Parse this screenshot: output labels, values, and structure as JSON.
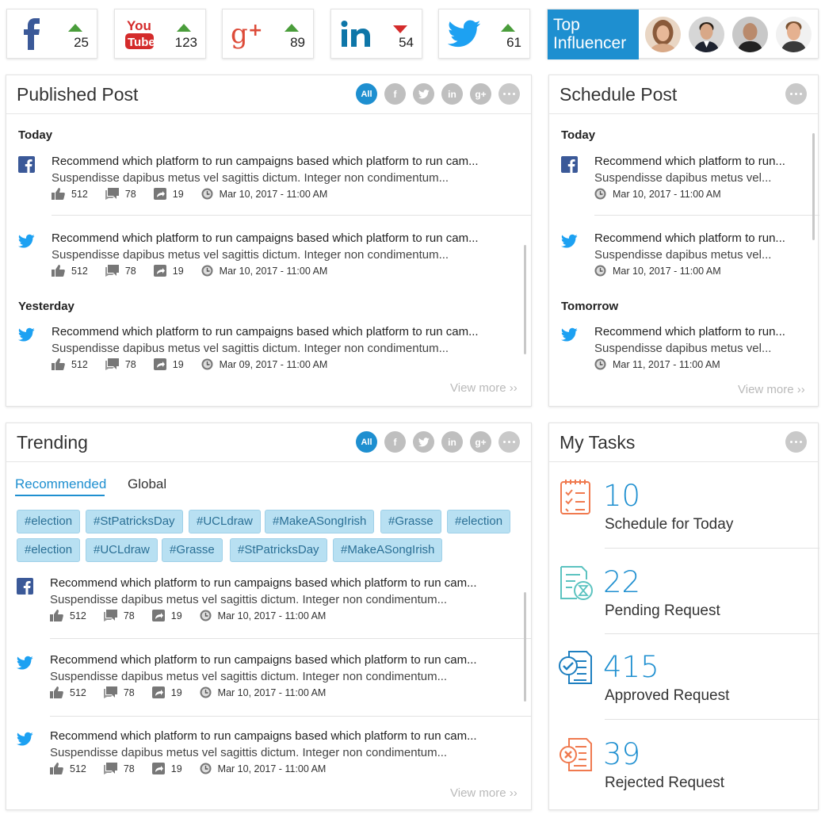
{
  "social_stats": [
    {
      "network": "facebook",
      "icon": "facebook-icon",
      "count": "25",
      "trend": "up"
    },
    {
      "network": "youtube",
      "icon": "youtube-icon",
      "count": "123",
      "trend": "up"
    },
    {
      "network": "google-plus",
      "icon": "google-plus-icon",
      "count": "89",
      "trend": "up"
    },
    {
      "network": "linkedin",
      "icon": "linkedin-icon",
      "count": "54",
      "trend": "down"
    },
    {
      "network": "twitter",
      "icon": "twitter-icon",
      "count": "61",
      "trend": "up"
    }
  ],
  "influencer": {
    "label_line1": "Top",
    "label_line2": "Influencer"
  },
  "filters": {
    "all": "All"
  },
  "published": {
    "title": "Published Post",
    "groups": [
      {
        "label": "Today"
      },
      {
        "label": "Yesterday"
      }
    ],
    "posts": [
      {
        "network": "facebook",
        "title": "Recommend which platform to run campaigns based which platform to run cam...",
        "desc": "Suspendisse dapibus metus vel sagittis dictum. Integer non condimentum...",
        "likes": "512",
        "comments": "78",
        "shares": "19",
        "date": "Mar 10, 2017 - 11:00 AM"
      },
      {
        "network": "twitter",
        "title": "Recommend which platform to run campaigns based which platform to run cam...",
        "desc": "Suspendisse dapibus metus vel sagittis dictum. Integer non condimentum...",
        "likes": "512",
        "comments": "78",
        "shares": "19",
        "date": "Mar 10, 2017 - 11:00 AM"
      },
      {
        "network": "twitter",
        "title": "Recommend which platform to run campaigns based which platform to run cam...",
        "desc": "Suspendisse dapibus metus vel sagittis dictum. Integer non condimentum...",
        "likes": "512",
        "comments": "78",
        "shares": "19",
        "date": "Mar 09, 2017 - 11:00 AM"
      }
    ],
    "view_more": "View more ››"
  },
  "schedule": {
    "title": "Schedule Post",
    "groups": [
      {
        "label": "Today"
      },
      {
        "label": "Tomorrow"
      }
    ],
    "posts": [
      {
        "network": "facebook",
        "title": "Recommend which platform to run...",
        "desc": "Suspendisse dapibus metus vel...",
        "date": "Mar 10, 2017 - 11:00 AM"
      },
      {
        "network": "twitter",
        "title": "Recommend which platform to run...",
        "desc": "Suspendisse dapibus metus vel...",
        "date": "Mar 10, 2017 - 11:00 AM"
      },
      {
        "network": "twitter",
        "title": "Recommend which platform to run...",
        "desc": "Suspendisse dapibus metus vel...",
        "date": "Mar 11, 2017 - 11:00 AM"
      }
    ],
    "view_more": "View more ››"
  },
  "trending": {
    "title": "Trending",
    "tabs": [
      {
        "label": "Recommended",
        "active": true
      },
      {
        "label": "Global",
        "active": false
      }
    ],
    "tags_row1": [
      "#election",
      "#StPatricksDay",
      "#UCLdraw",
      "#MakeASongIrish",
      "#Grasse",
      "#election"
    ],
    "tags_row2": [
      "#election",
      "#UCLdraw",
      "#Grasse",
      "#StPatricksDay",
      "#MakeASongIrish"
    ],
    "posts": [
      {
        "network": "facebook",
        "title": "Recommend which platform to run campaigns based which platform to run cam...",
        "desc": "Suspendisse dapibus metus vel sagittis dictum. Integer non condimentum...",
        "likes": "512",
        "comments": "78",
        "shares": "19",
        "date": "Mar 10, 2017 - 11:00 AM"
      },
      {
        "network": "twitter",
        "title": "Recommend which platform to run campaigns based which platform to run cam...",
        "desc": "Suspendisse dapibus metus vel sagittis dictum. Integer non condimentum...",
        "likes": "512",
        "comments": "78",
        "shares": "19",
        "date": "Mar 10, 2017 - 11:00 AM"
      },
      {
        "network": "twitter",
        "title": "Recommend which platform to run campaigns based which platform to run cam...",
        "desc": "Suspendisse dapibus metus vel sagittis dictum. Integer non condimentum...",
        "likes": "512",
        "comments": "78",
        "shares": "19",
        "date": "Mar 10, 2017 - 11:00 AM"
      }
    ],
    "view_more": "View more ››"
  },
  "tasks": {
    "title": "My Tasks",
    "items": [
      {
        "count": "10",
        "label": "Schedule for Today",
        "icon": "schedule-checklist-icon",
        "color": "#f07a4f"
      },
      {
        "count": "22",
        "label": "Pending Request",
        "icon": "pending-hourglass-icon",
        "color": "#5cc3c0"
      },
      {
        "count": "415",
        "label": "Approved Request",
        "icon": "approved-check-icon",
        "color": "#1e7fc0"
      },
      {
        "count": "39",
        "label": "Rejected Request",
        "icon": "rejected-x-icon",
        "color": "#f07a4f"
      }
    ]
  },
  "colors": {
    "accent": "#1e8fd0",
    "up": "#4a9d3b",
    "down": "#d42b2b",
    "facebook": "#3b5998",
    "twitter": "#1da1f2",
    "youtube": "#d42b2b",
    "google": "#dd4b39",
    "linkedin": "#0e76a8"
  }
}
